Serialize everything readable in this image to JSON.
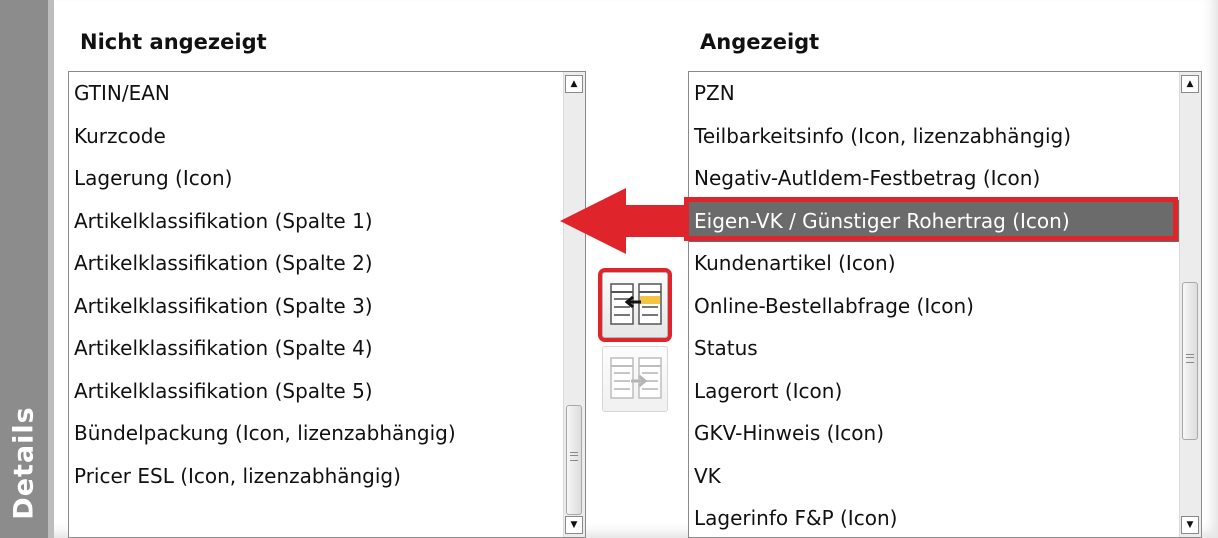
{
  "sidebar": {
    "label": "Details"
  },
  "left_list": {
    "header": "Nicht angezeigt",
    "items": [
      "GTIN/EAN",
      "Kurzcode",
      "Lagerung (Icon)",
      "Artikelklassifikation (Spalte 1)",
      "Artikelklassifikation (Spalte 2)",
      "Artikelklassifikation (Spalte 3)",
      "Artikelklassifikation (Spalte 4)",
      "Artikelklassifikation (Spalte 5)",
      "Bündelpackung (Icon, lizenzabhängig)",
      "Pricer ESL (Icon, lizenzabhängig)"
    ]
  },
  "right_list": {
    "header": "Angezeigt",
    "selected_index": 3,
    "items": [
      "PZN",
      "Teilbarkeitsinfo (Icon, lizenzabhängig)",
      "Negativ-AutIdem-Festbetrag (Icon)",
      "Eigen-VK / Günstiger Rohertrag (Icon)",
      "Kundenartikel (Icon)",
      "Online-Bestellabfrage (Icon)",
      "Status",
      "Lagerort (Icon)",
      "GKV-Hinweis (Icon)",
      "VK",
      "Lagerinfo F&P (Icon)"
    ]
  },
  "buttons": {
    "move_left_icon": "move-to-left-list-icon",
    "move_right_icon": "move-to-right-list-icon"
  },
  "colors": {
    "highlight": "#e0242b",
    "selection": "#6b6b6b",
    "sidebar": "#8c8c8c"
  }
}
